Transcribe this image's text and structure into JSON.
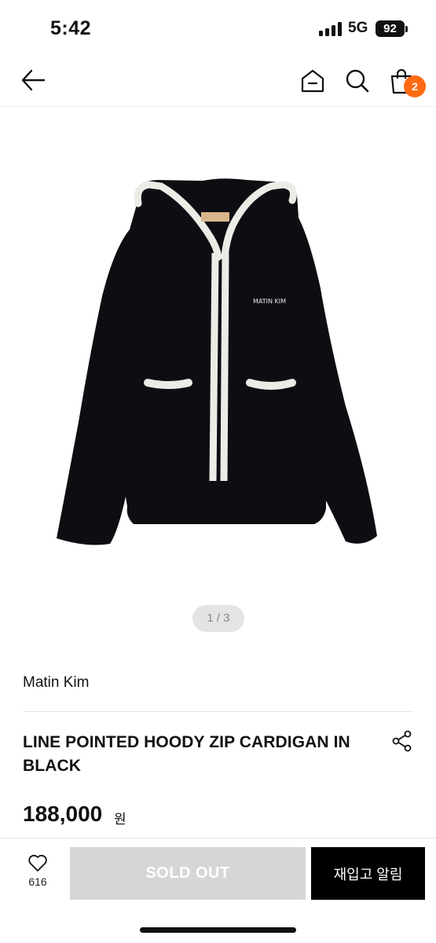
{
  "status_bar": {
    "time": "5:42",
    "network": "5G",
    "battery": "92"
  },
  "nav": {
    "icons": [
      "arrow-left-icon",
      "home-icon",
      "search-icon",
      "shopping-bag-icon"
    ],
    "cart_count": "2",
    "badge_color": "#ff6a13"
  },
  "image": {
    "pager": "1 / 3",
    "label_text": "MATIN KIM"
  },
  "product": {
    "brand": "Matin Kim",
    "name": "LINE POINTED HOODY ZIP CARDIGAN IN BLACK",
    "price": "188,000",
    "currency": "원"
  },
  "bottom": {
    "wish_count": "616",
    "sold_out_label": "SOLD OUT",
    "restock_label": "재입고 알림",
    "sold_out_color": "#d6d6d6",
    "restock_color": "#000000"
  }
}
